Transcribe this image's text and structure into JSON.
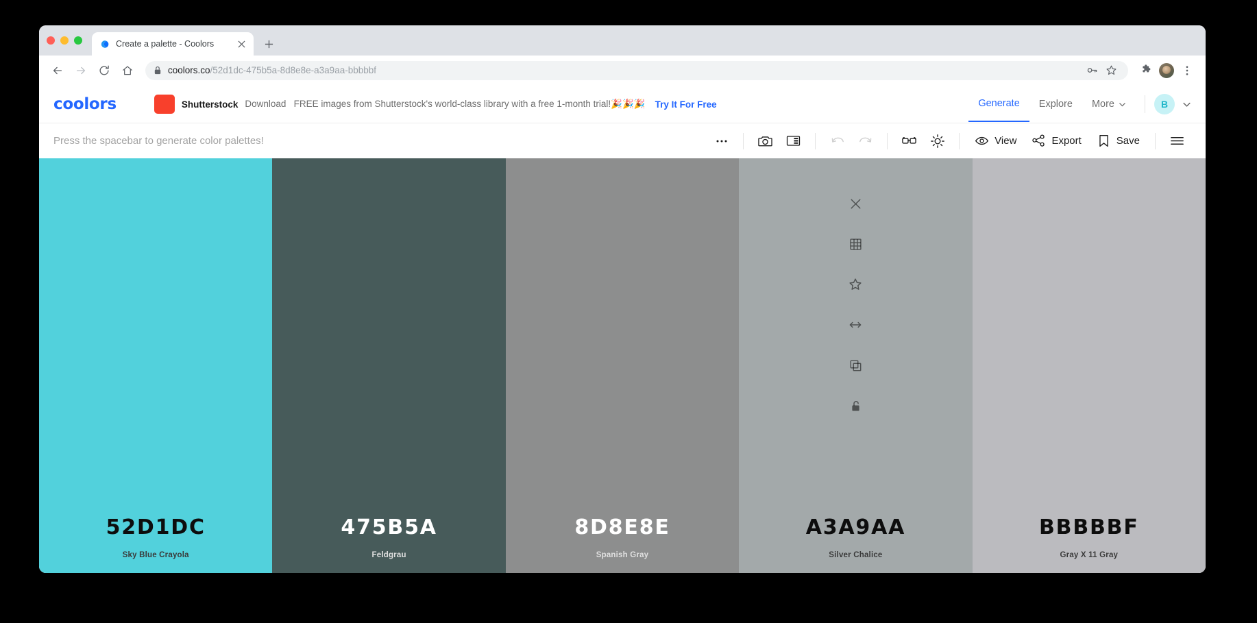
{
  "browser": {
    "tab": {
      "title": "Create a palette - Coolors",
      "favicon": "coolors-favicon"
    },
    "new_tab_label": "+",
    "omnibox": {
      "domain": "coolors.co",
      "path": "/52d1dc-475b5a-8d8e8e-a3a9aa-bbbbbf",
      "full_url": "coolors.co/52d1dc-475b5a-8d8e8e-a3a9aa-bbbbbf"
    },
    "icons": {
      "back": "back-arrow-icon",
      "forward": "forward-arrow-icon",
      "reload": "reload-icon",
      "home": "home-icon",
      "lock": "lock-icon",
      "password": "key-icon",
      "bookmark": "star-icon",
      "extensions": "puzzle-icon",
      "profile": "profile-avatar-icon",
      "menu": "three-dot-menu-icon"
    }
  },
  "app": {
    "logo": "coolors",
    "promo": {
      "brand": "Shutterstock",
      "text": "Download   FREE images from Shutterstock's world-class library with a free 1-month trial!🎉🎉🎉",
      "cta": "Try It For Free",
      "logo_color": "#f8402c"
    },
    "nav": [
      {
        "label": "Generate",
        "active": true
      },
      {
        "label": "Explore",
        "active": false
      },
      {
        "label": "More",
        "active": false,
        "caret": true
      }
    ],
    "user": {
      "initial": "B",
      "avatar_bg": "#c7f2f6",
      "avatar_fg": "#1fb6c9"
    },
    "accent_color": "#2467ff"
  },
  "toolbar": {
    "hint": "Press the spacebar to generate color palettes!",
    "icon_buttons": [
      {
        "name": "more-options-icon",
        "enabled": true
      },
      {
        "name": "camera-icon",
        "enabled": true
      },
      {
        "name": "layout-panel-icon",
        "enabled": true
      },
      {
        "name": "undo-icon",
        "enabled": false
      },
      {
        "name": "redo-icon",
        "enabled": false
      },
      {
        "name": "glasses-icon",
        "enabled": true
      },
      {
        "name": "brightness-icon",
        "enabled": true
      }
    ],
    "labeled_buttons": [
      {
        "label": "View",
        "icon": "eye-icon"
      },
      {
        "label": "Export",
        "icon": "share-nodes-icon"
      },
      {
        "label": "Save",
        "icon": "bookmark-icon"
      }
    ],
    "menu_icon": "hamburger-menu-icon"
  },
  "palette": {
    "colors": [
      {
        "hex": "52D1DC",
        "name": "Sky Blue Crayola",
        "css": "#52d1dc",
        "text": "dark"
      },
      {
        "hex": "475B5A",
        "name": "Feldgrau",
        "css": "#475b5a",
        "text": "light"
      },
      {
        "hex": "8D8E8E",
        "name": "Spanish Gray",
        "css": "#8d8e8e",
        "text": "light"
      },
      {
        "hex": "A3A9AA",
        "name": "Silver Chalice",
        "css": "#a3a9aa",
        "text": "dark"
      },
      {
        "hex": "BBBBBF",
        "name": "Gray X 11 Gray",
        "css": "#bbbbbf",
        "text": "dark"
      }
    ],
    "hovered_index": 3,
    "column_actions": [
      "close-icon",
      "grid-shades-icon",
      "star-favorite-icon",
      "drag-horizontal-icon",
      "copy-icon",
      "unlock-icon"
    ]
  }
}
